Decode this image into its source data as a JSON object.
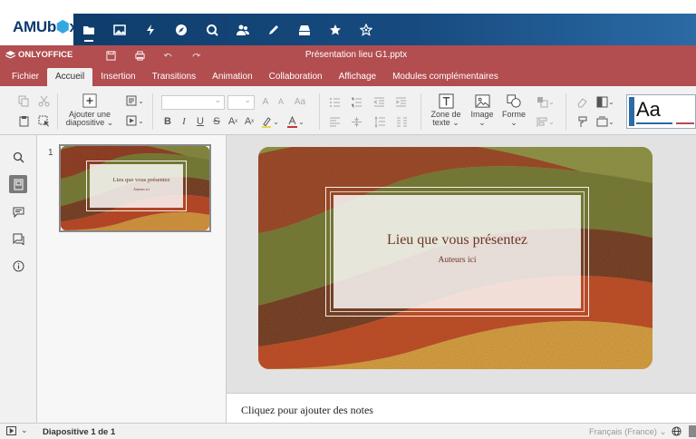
{
  "portal": {
    "logo_text": "AMU",
    "logo_box": "b",
    "logo_suffix": "x",
    "nav_icons": [
      "folder-icon",
      "image-icon",
      "bolt-icon",
      "compass-icon",
      "search-icon",
      "people-icon",
      "pen-icon",
      "drive-icon",
      "star-icon",
      "settings-star-icon"
    ]
  },
  "header": {
    "brand": "ONLYOFFICE",
    "document_title": "Présentation lieu G1.pptx"
  },
  "menu": {
    "tabs": [
      "Fichier",
      "Accueil",
      "Insertion",
      "Transitions",
      "Animation",
      "Collaboration",
      "Affichage",
      "Modules complémentaires"
    ],
    "active_tab": "Accueil"
  },
  "toolbar": {
    "add_slide_line1": "Ajouter une",
    "add_slide_line2": "diapositive ⌄",
    "font_size_buttons": [
      "A",
      "A",
      "Aa"
    ],
    "format_buttons": [
      "B",
      "I",
      "U",
      "S",
      "A",
      "A"
    ],
    "text_box_line1": "Zone de",
    "text_box_line2": "texte ⌄",
    "image_label": "Image",
    "image_caret": "⌄",
    "shape_label": "Forme",
    "shape_caret": "⌄",
    "theme_preview": "Aa"
  },
  "thumbnails": {
    "number": "1",
    "title": "Lieu que vous présentez",
    "subtitle": "Auteurs ici"
  },
  "slide": {
    "title": "Lieu que vous présentez",
    "subtitle": "Auteurs ici"
  },
  "notes": {
    "placeholder": "Cliquez pour ajouter des notes"
  },
  "status": {
    "slide_count": "Diapositive 1 de 1",
    "language": "Français (France) ⌄"
  },
  "colors": {
    "header": "#b24d50",
    "portal_nav": "#174b80",
    "slide_text": "#6e3425"
  }
}
